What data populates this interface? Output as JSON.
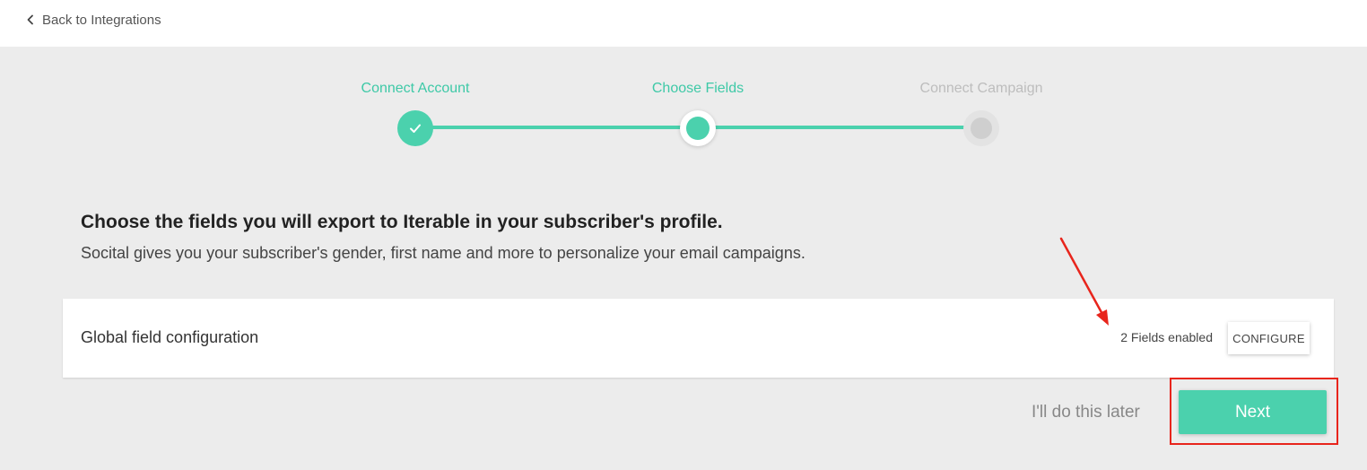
{
  "nav": {
    "back_label": "Back to Integrations"
  },
  "stepper": {
    "steps": [
      {
        "label": "Connect Account",
        "state": "done"
      },
      {
        "label": "Choose Fields",
        "state": "active"
      },
      {
        "label": "Connect Campaign",
        "state": "todo"
      }
    ]
  },
  "content": {
    "heading": "Choose the fields you will export to Iterable in your subscriber's profile.",
    "subheading": "Socital gives you your subscriber's gender, first name and more to personalize your email campaigns."
  },
  "card": {
    "title": "Global field configuration",
    "fields_enabled": "2 Fields enabled",
    "configure_label": "CONFIGURE"
  },
  "actions": {
    "later_label": "I'll do this later",
    "next_label": "Next"
  },
  "colors": {
    "accent": "#4bd1ad",
    "annotation": "#e8251c",
    "background": "#ececec"
  },
  "icons": {
    "back": "chevron-left-icon",
    "done": "check-icon"
  }
}
